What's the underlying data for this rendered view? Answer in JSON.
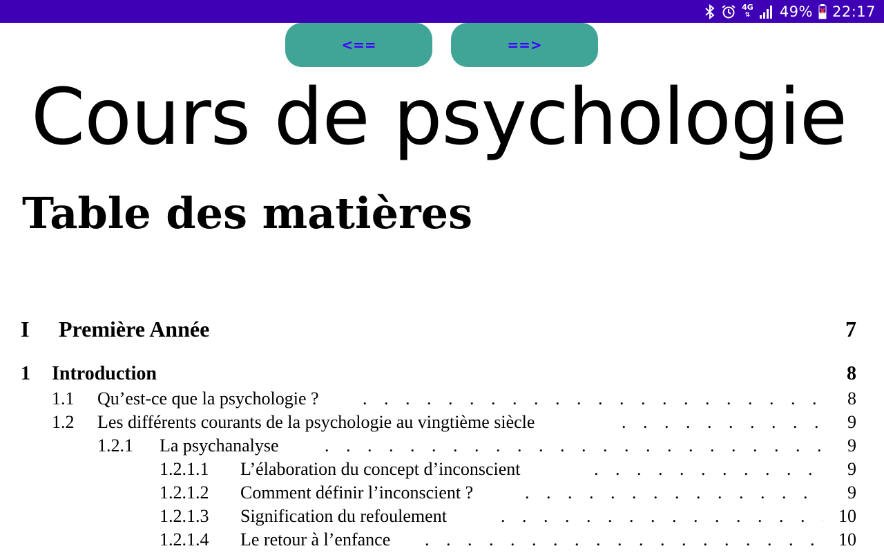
{
  "status_bar": {
    "network_type": "4G",
    "battery_percent": "49%",
    "time": "22:17",
    "icons": [
      "bluetooth-icon",
      "alarm-icon",
      "signal-icon",
      "battery-icon"
    ],
    "background": "#3f00b5"
  },
  "nav": {
    "prev_label": "<==",
    "next_label": "==>",
    "button_color": "#40a597",
    "label_color": "#3f00ff"
  },
  "document": {
    "title": "Cours de psychologie",
    "toc_heading": "Table des matières"
  },
  "toc": {
    "part": {
      "num": "I",
      "title": "Première Année",
      "page": "7"
    },
    "chapter": {
      "num": "1",
      "title": "Introduction",
      "page": "8"
    },
    "entries": [
      {
        "num": "1.1",
        "title": "Qu’est-ce que la psychologie ?",
        "page": "8"
      },
      {
        "num": "1.2",
        "title": "Les différents courants de la psychologie au vingtième siècle",
        "page": "9"
      },
      {
        "num": "1.2.1",
        "title": "La psychanalyse",
        "page": "9"
      },
      {
        "num": "1.2.1.1",
        "title": "L’élaboration du concept d’inconscient",
        "page": "9"
      },
      {
        "num": "1.2.1.2",
        "title": "Comment définir l’inconscient ?",
        "page": "9"
      },
      {
        "num": "1.2.1.3",
        "title": "Signification du refoulement",
        "page": "10"
      },
      {
        "num": "1.2.1.4",
        "title": "Le retour à l’enfance",
        "page": "10"
      }
    ]
  }
}
